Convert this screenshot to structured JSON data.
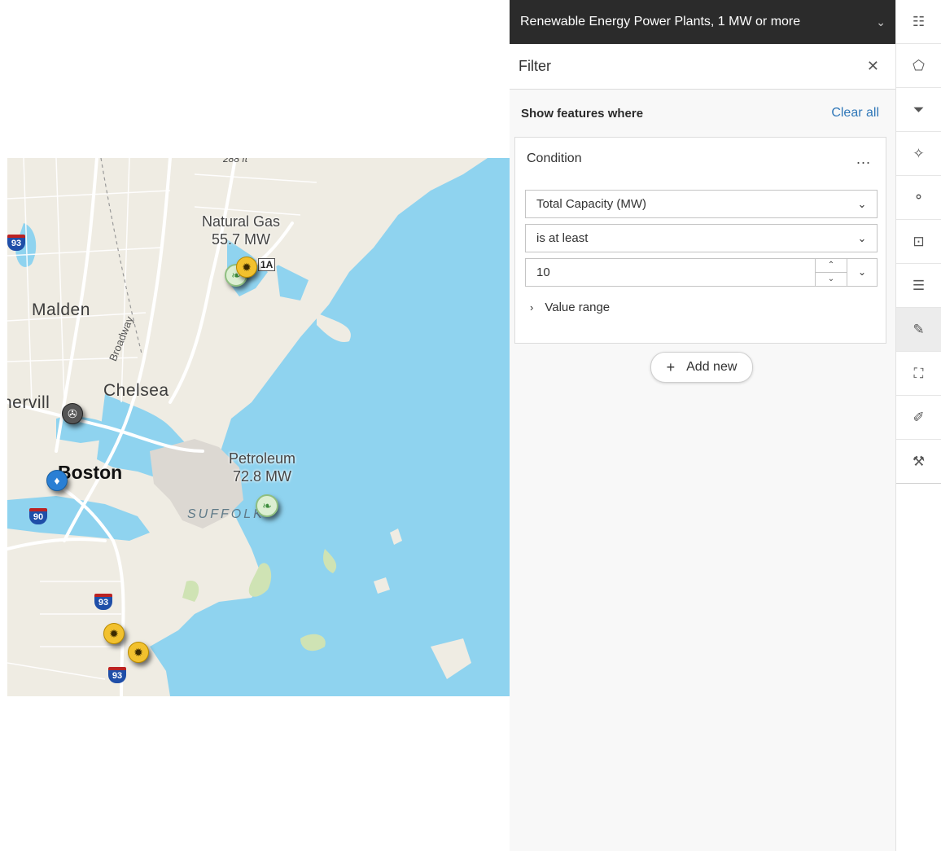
{
  "map": {
    "places": {
      "malden": "Malden",
      "chelsea": "Chelsea",
      "somerville": "nervill",
      "boston": "Boston",
      "suffolk": "SUFFOLK",
      "broadway": "Broadway",
      "elevation": "288 ft"
    },
    "popups": {
      "natural_gas_line1": "Natural Gas",
      "natural_gas_line2": "55.7 MW",
      "petroleum_line1": "Petroleum",
      "petroleum_line2": "72.8 MW"
    },
    "shields": {
      "i93_top": "93",
      "i90": "90",
      "i93_mid": "93",
      "i93_bottom": "93",
      "exit_1a": "1A"
    },
    "colors": {
      "water": "#8fd3ef",
      "land": "#efece3",
      "solar": "#f2c12e",
      "biomass": "#dcefd2",
      "wind": "#555555",
      "hydro": "#2a7fd4"
    }
  },
  "panel": {
    "layer_title": "Renewable Energy Power Plants, 1 MW or more",
    "filter_title": "Filter",
    "show_features_label": "Show features where",
    "clear_all_label": "Clear all",
    "condition": {
      "title": "Condition",
      "more_label": "...",
      "field_value": "Total Capacity (MW)",
      "operator_value": "is at least",
      "input_value": "10",
      "value_range_label": "Value range"
    },
    "add_new_label": "Add new"
  },
  "rail": {
    "tools": [
      "properties-icon",
      "styles-icon",
      "filter-icon",
      "effects-icon",
      "clustering-icon",
      "popups-icon",
      "labels-icon",
      "edit-icon",
      "configure-fields-icon",
      "sketch-icon",
      "tools-icon"
    ]
  }
}
